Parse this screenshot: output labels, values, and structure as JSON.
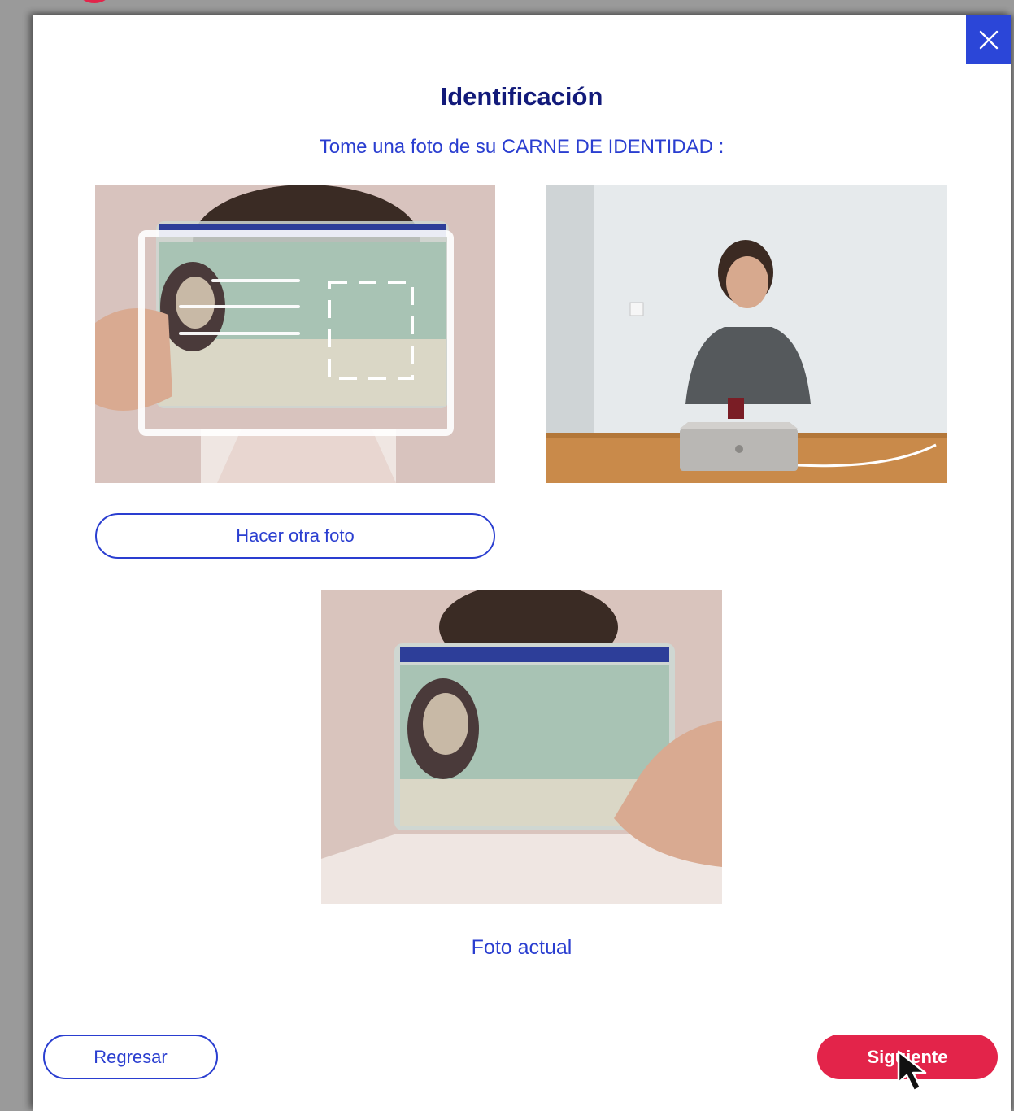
{
  "modal": {
    "title": "Identificación",
    "subtitle": "Tome una foto de su CARNE DE IDENTIDAD :",
    "close_icon": "close-icon"
  },
  "photos": {
    "id_capture": "id-card-capture-with-guide-overlay",
    "example": "man-at-desk-with-passport-example",
    "current": "id-card-current-photo"
  },
  "buttons": {
    "retake": "Hacer otra foto",
    "back": "Regresar",
    "next": "Siguiente"
  },
  "caption": "Foto actual",
  "colors": {
    "primary_blue": "#2a3ed0",
    "title_navy": "#121a7a",
    "accent_red": "#e3244a",
    "close_bg": "#2b46d8"
  }
}
